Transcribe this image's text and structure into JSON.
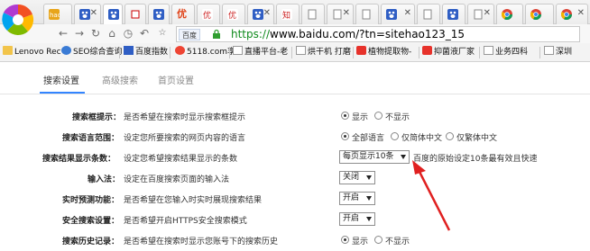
{
  "browser": {
    "tabs": [
      {
        "label": "hao"
      },
      {
        "label": "baidu"
      },
      {
        "label": "baidu"
      },
      {
        "label": "tmall"
      },
      {
        "label": "baidu"
      },
      {
        "label": "youhui",
        "text": "优"
      },
      {
        "label": "youku"
      },
      {
        "label": "youku"
      },
      {
        "label": "baidu"
      },
      {
        "label": "zhihu"
      },
      {
        "label": "page"
      },
      {
        "label": "baidu"
      },
      {
        "label": "page"
      },
      {
        "label": "chrome"
      },
      {
        "label": "chrome"
      },
      {
        "label": "chrome"
      }
    ],
    "site_label": "百度",
    "url_scheme": "https://",
    "url_rest": "www.baidu.com/?tn=sitehao123_15",
    "bookmarks": [
      "Lenovo Rec",
      "SEO综合查询",
      "百度指数",
      "5118.com享",
      "直播平台-老",
      "烘干机 打磨",
      "植物提取物-",
      "抑菌液厂家",
      "业务四科",
      "深圳"
    ]
  },
  "settings_tabs": [
    "搜索设置",
    "高级搜索",
    "首页设置"
  ],
  "rows": [
    {
      "label": "搜索框提示：",
      "desc": "是否希望在搜索时显示搜索框提示",
      "options": [
        "显示",
        "不显示"
      ],
      "selected": 0
    },
    {
      "label": "搜索语言范围：",
      "desc": "设定您所要搜索的网页内容的语言",
      "options": [
        "全部语言",
        "仅简体中文",
        "仅繁体中文"
      ],
      "selected": 0
    },
    {
      "label": "搜索结果显示条数：",
      "desc": "设定您希望搜索结果显示的条数",
      "select_value": "每页显示10条",
      "note": "百度的原始设定10条最有效且快速"
    },
    {
      "label": "输入法：",
      "desc": "设定在百度搜索页面的输入法",
      "select_value": "关闭"
    },
    {
      "label": "实时预测功能：",
      "desc": "是否希望在您输入时实时展现搜索结果",
      "select_value": "开启"
    },
    {
      "label": "安全搜索设置：",
      "desc": "是否希望开启HTTPS安全搜索模式",
      "select_value": "开启"
    },
    {
      "label": "搜索历史记录：",
      "desc": "是否希望在搜索时显示您账号下的搜索历史",
      "options": [
        "显示",
        "不显示"
      ],
      "selected": 0
    }
  ],
  "colors": {
    "accent": "#3385ff",
    "arrow": "#e02020",
    "url_green": "#0f8a1c"
  }
}
